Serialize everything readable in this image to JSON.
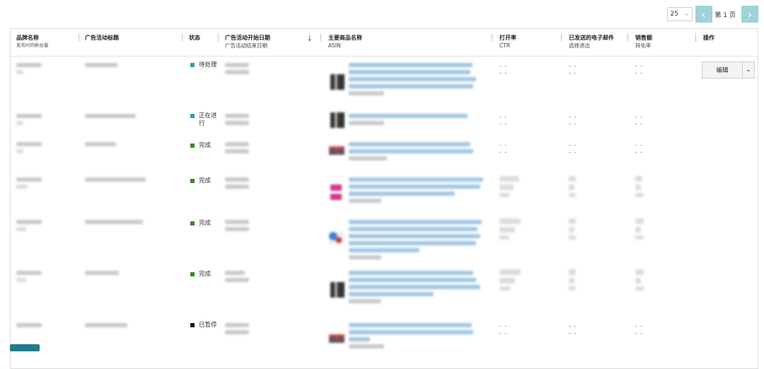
{
  "pager": {
    "per_page": "25",
    "page_label": "第 1 页",
    "prev_icon": "chevron-left",
    "next_icon": "chevron-right"
  },
  "header": {
    "col_brand": "品牌名称",
    "col_brand_sub": "发布时的粉丝量",
    "col_title": "广告活动标题",
    "col_status": "状态",
    "col_start": "广告活动开始日期",
    "col_start_sub": "广告活动结束日期",
    "col_product": "主要商品名称",
    "col_product_sub": "ASIN",
    "col_open": "打开率",
    "col_open_sub": "CTR",
    "col_email": "已发送的电子邮件",
    "col_email_sub": "选择退出",
    "col_sales": "销售额",
    "col_sales_sub": "转化率",
    "col_action": "操作"
  },
  "rows": [
    {
      "status": "待处理",
      "status_color": "#2a9fbf",
      "dash1": "- -",
      "dash2": "- -",
      "edit": "编辑"
    },
    {
      "status": "正在进行",
      "status_color": "#2a9fbf",
      "dash1": "- -",
      "dash2": "- -"
    },
    {
      "status": "完成",
      "status_color": "#3a8a2a",
      "dash1": "- -",
      "dash2": "- -"
    },
    {
      "status": "完成",
      "status_color": "#3a8a2a"
    },
    {
      "status": "完成",
      "status_color": "#3a8a2a"
    },
    {
      "status": "完成",
      "status_color": "#3a8a2a"
    },
    {
      "status": "已暂停",
      "status_color": "#111111",
      "dash1": "- -",
      "dash2": "- -"
    }
  ]
}
